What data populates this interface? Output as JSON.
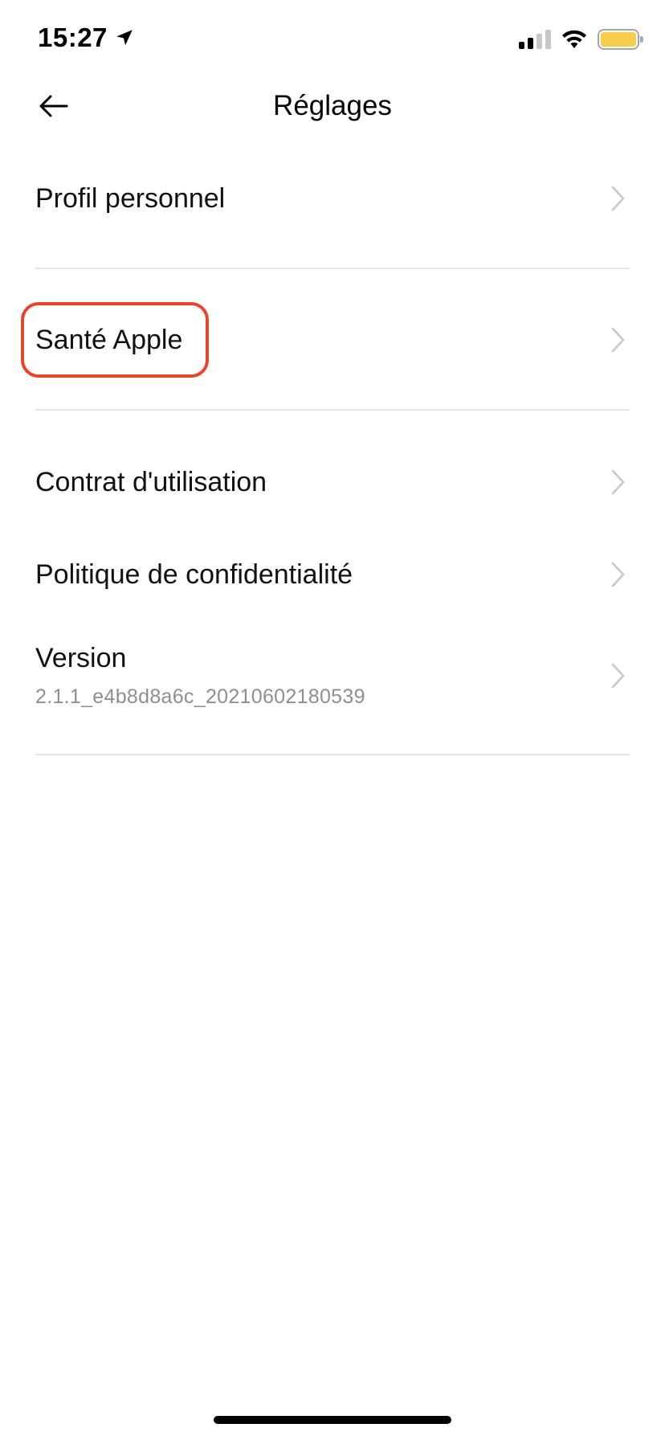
{
  "status_bar": {
    "time": "15:27",
    "location_icon": "location-arrow-icon",
    "signal_icon": "cellular-signal-icon",
    "wifi_icon": "wifi-icon",
    "battery_icon": "battery-icon",
    "battery_color": "#f5cd4a"
  },
  "nav": {
    "back_icon": "back-arrow-icon",
    "title": "Réglages"
  },
  "settings": {
    "items": [
      {
        "label": "Profil personnel",
        "icon": "chevron-right-icon"
      },
      {
        "label": "Santé Apple",
        "icon": "chevron-right-icon"
      },
      {
        "label": "Contrat d'utilisation",
        "icon": "chevron-right-icon"
      },
      {
        "label": "Politique de confidentialité",
        "icon": "chevron-right-icon"
      },
      {
        "label": "Version",
        "sublabel": "2.1.1_e4b8d8a6c_20210602180539",
        "icon": "chevron-right-icon"
      }
    ]
  },
  "annotation": {
    "highlight_color": "#e8432c"
  }
}
